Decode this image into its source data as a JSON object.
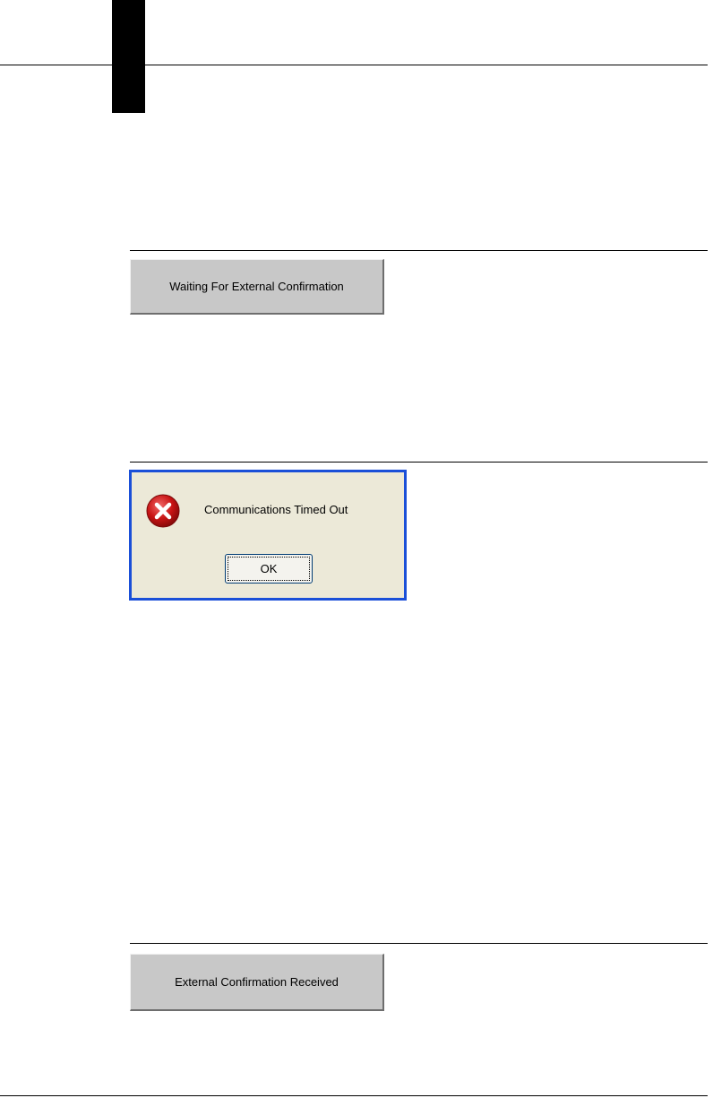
{
  "status_panels": {
    "waiting": {
      "label": "Waiting For External Confirmation"
    },
    "received": {
      "label": "External Confirmation Received"
    }
  },
  "error_dialog": {
    "icon": "error-x-icon",
    "message": "Communications Timed Out",
    "ok_label": "OK"
  },
  "colors": {
    "dialog_border": "#1a4fd8",
    "dialog_background": "#ece9d8",
    "panel_background": "#c8c8c8",
    "error_icon_red": "#c81414"
  }
}
